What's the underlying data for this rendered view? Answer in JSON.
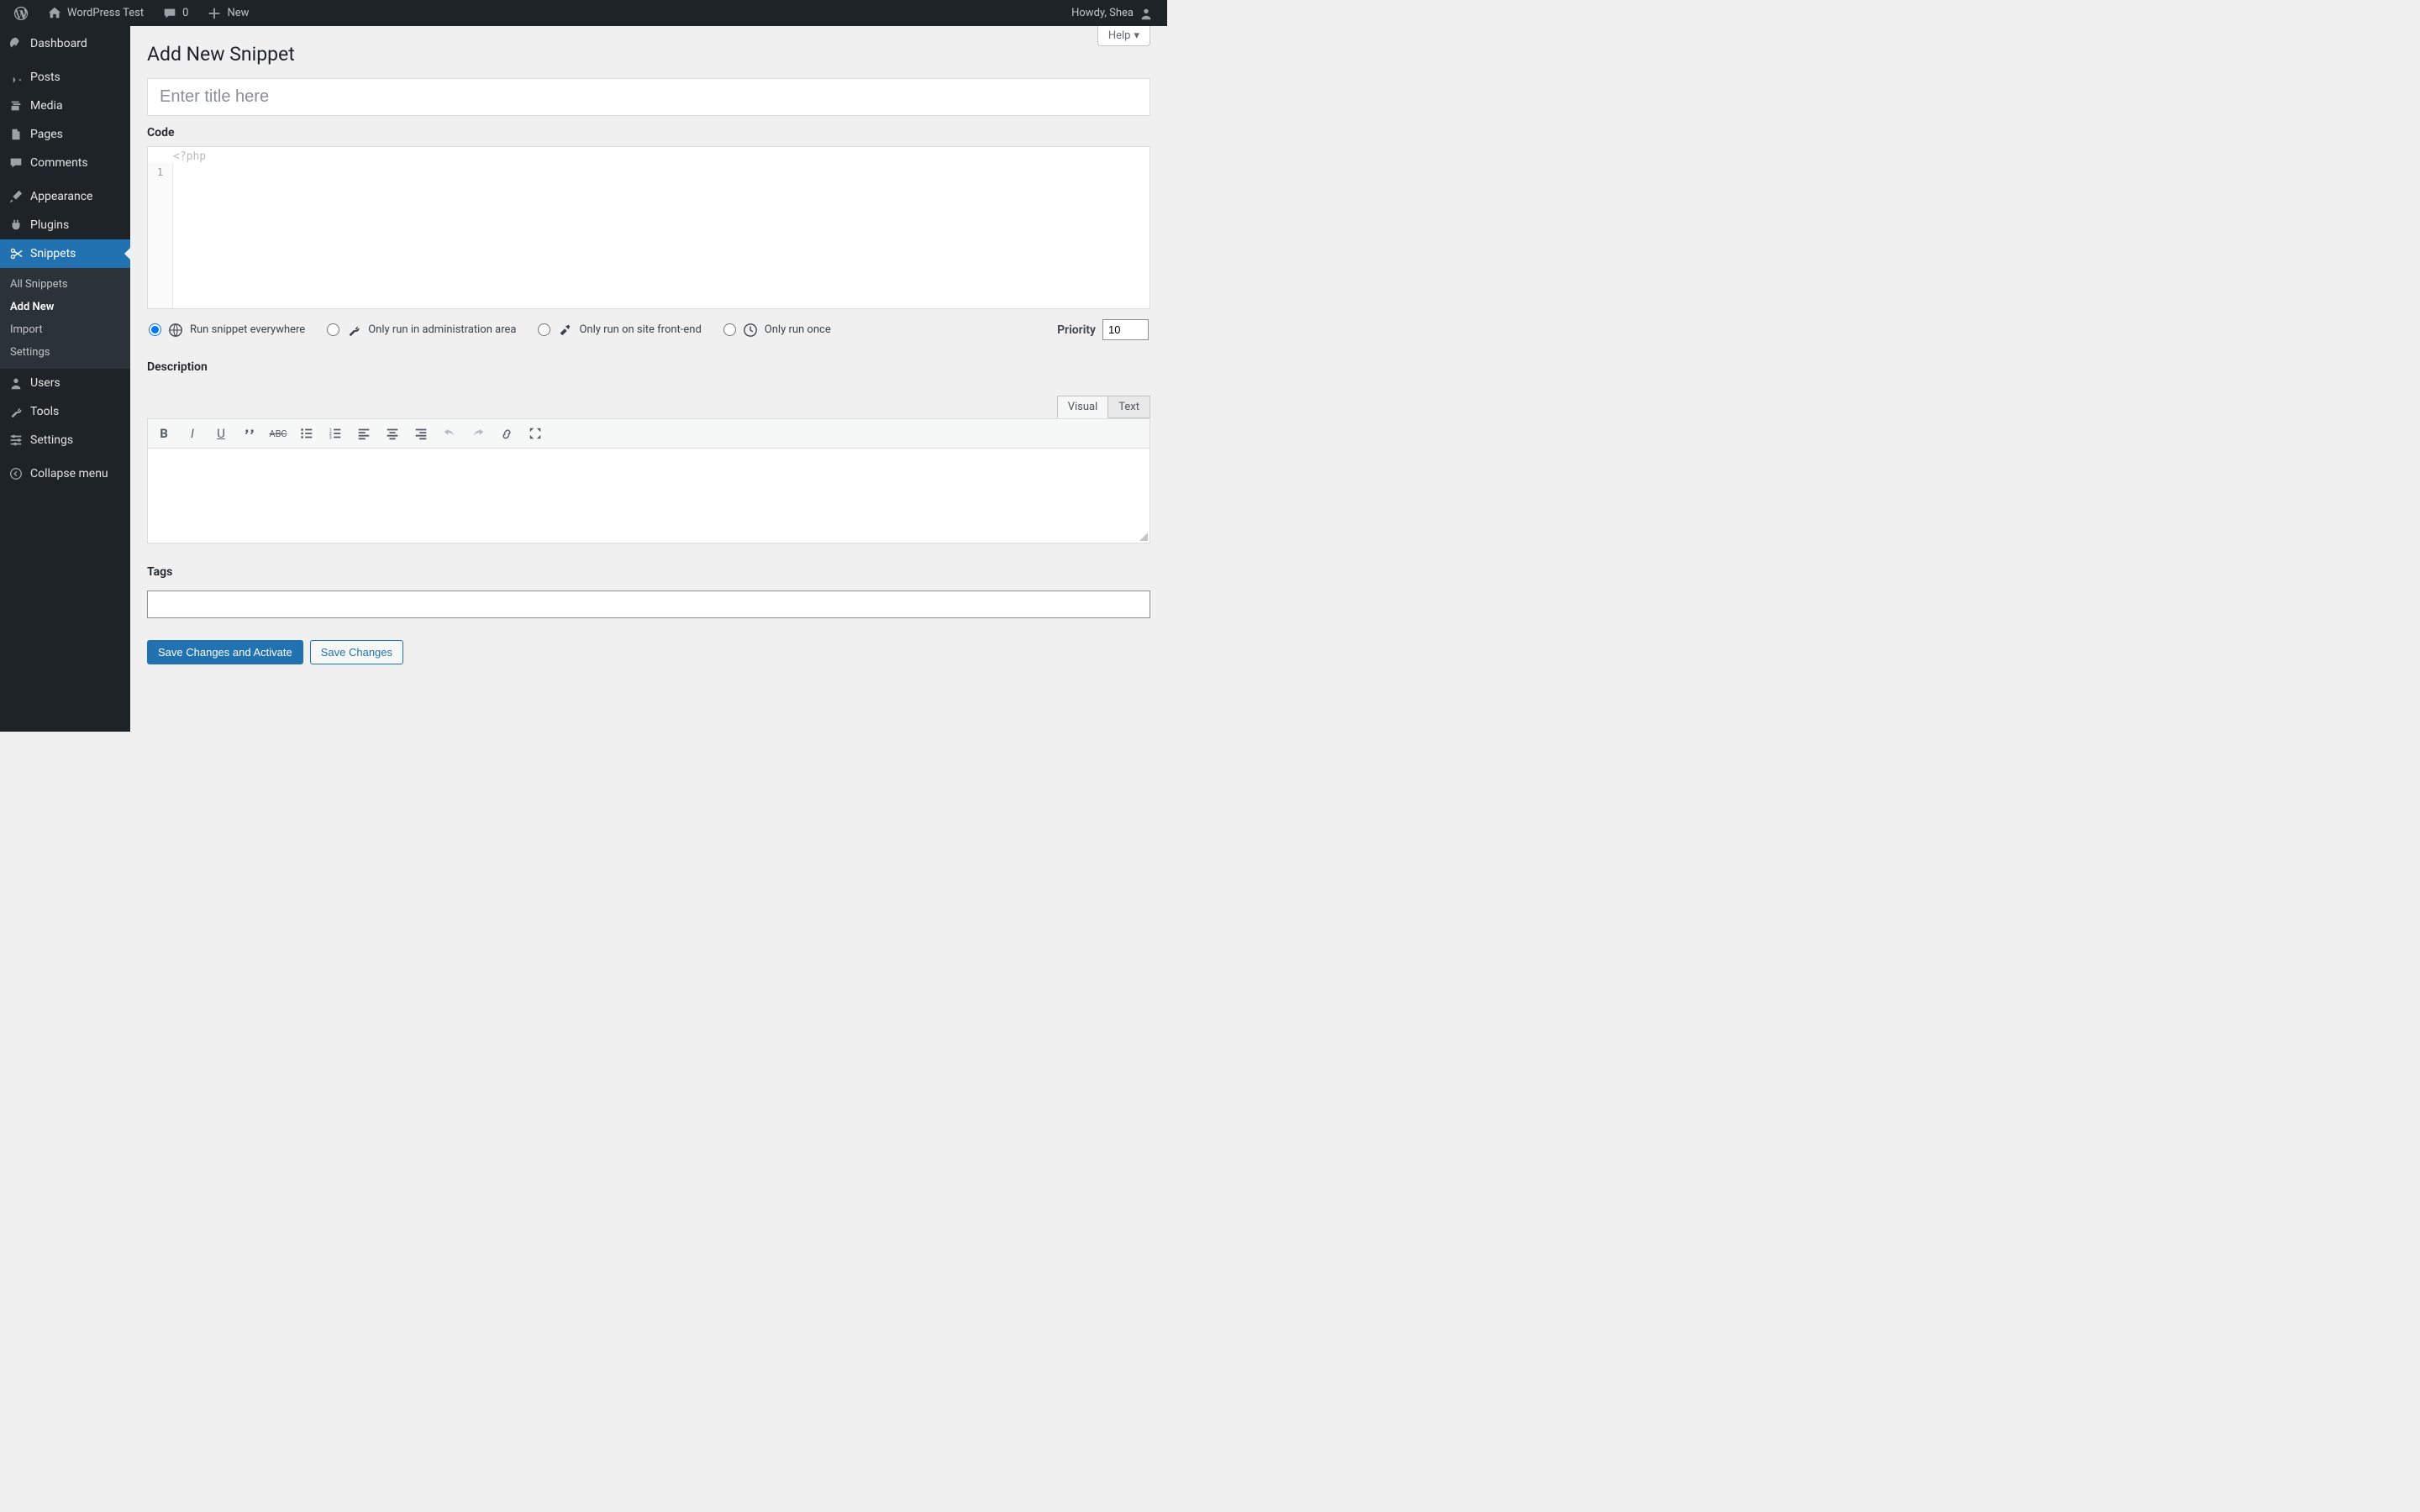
{
  "admin_bar": {
    "site_title": "WordPress Test",
    "comments_count": "0",
    "new_label": "New",
    "howdy": "Howdy, Shea"
  },
  "sidebar": {
    "items": [
      {
        "label": "Dashboard"
      },
      {
        "label": "Posts"
      },
      {
        "label": "Media"
      },
      {
        "label": "Pages"
      },
      {
        "label": "Comments"
      },
      {
        "label": "Appearance"
      },
      {
        "label": "Plugins"
      },
      {
        "label": "Snippets"
      },
      {
        "label": "Users"
      },
      {
        "label": "Tools"
      },
      {
        "label": "Settings"
      }
    ],
    "submenu": [
      {
        "label": "All Snippets"
      },
      {
        "label": "Add New"
      },
      {
        "label": "Import"
      },
      {
        "label": "Settings"
      }
    ],
    "collapse": "Collapse menu"
  },
  "page": {
    "title": "Add New Snippet",
    "help": "Help",
    "title_placeholder": "Enter title here",
    "code_heading": "Code",
    "code_prefix": "<?php",
    "line_no": "1",
    "scope": {
      "everywhere": "Run snippet everywhere",
      "admin": "Only run in administration area",
      "frontend": "Only run on site front-end",
      "once": "Only run once",
      "selected": "everywhere"
    },
    "priority_label": "Priority",
    "priority_value": "10",
    "description_heading": "Description",
    "tabs": {
      "visual": "Visual",
      "text": "Text"
    },
    "tags_heading": "Tags",
    "save_activate": "Save Changes and Activate",
    "save": "Save Changes"
  }
}
